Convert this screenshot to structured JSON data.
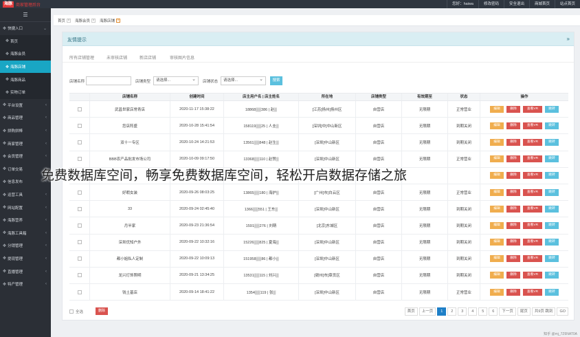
{
  "app": {
    "logo_text": "海豚",
    "logo_sub": "商家管理后台"
  },
  "top_links": [
    "您好：haiwa",
    "修改密码",
    "安全退出",
    "商城首页",
    "站点首页"
  ],
  "sidebar": {
    "toggle_icon": "menu-icon",
    "items": [
      {
        "label": "快捷入口",
        "sub": false,
        "active": false,
        "chev": "⌄"
      },
      {
        "label": "首页",
        "sub": true,
        "active": false,
        "chev": ""
      },
      {
        "label": "海豚会员",
        "sub": true,
        "active": false,
        "chev": ""
      },
      {
        "label": "海豚店铺",
        "sub": true,
        "active": true,
        "chev": ""
      },
      {
        "label": "海豚商品",
        "sub": true,
        "active": false,
        "chev": ""
      },
      {
        "label": "实物订单",
        "sub": true,
        "active": false,
        "chev": ""
      },
      {
        "label": "平台设置",
        "sub": false,
        "active": false,
        "chev": "‹"
      },
      {
        "label": "商品管理",
        "sub": false,
        "active": false,
        "chev": "‹"
      },
      {
        "label": "拼购拼棒",
        "sub": false,
        "active": false,
        "chev": "‹"
      },
      {
        "label": "商家管理",
        "sub": false,
        "active": false,
        "chev": "‹"
      },
      {
        "label": "会员管理",
        "sub": false,
        "active": false,
        "chev": "‹"
      },
      {
        "label": "订单交易",
        "sub": false,
        "active": false,
        "chev": "‹"
      },
      {
        "label": "信息发布",
        "sub": false,
        "active": false,
        "chev": "‹"
      },
      {
        "label": "运营工具",
        "sub": false,
        "active": false,
        "chev": "‹"
      },
      {
        "label": "网站配置",
        "sub": false,
        "active": false,
        "chev": "‹"
      },
      {
        "label": "海豚营养",
        "sub": false,
        "active": false,
        "chev": "‹"
      },
      {
        "label": "海豚工具箱",
        "sub": false,
        "active": false,
        "chev": "‹"
      },
      {
        "label": "分销管理",
        "sub": false,
        "active": false,
        "chev": "‹"
      },
      {
        "label": "提现管理",
        "sub": false,
        "active": false,
        "chev": "‹"
      },
      {
        "label": "直播管理",
        "sub": false,
        "active": false,
        "chev": "‹"
      },
      {
        "label": "特产管理",
        "sub": false,
        "active": false,
        "chev": "‹"
      }
    ]
  },
  "tabs": [
    {
      "label": "首页",
      "active": false
    },
    {
      "label": "海豚会员",
      "active": false
    },
    {
      "label": "海豚店铺",
      "active": true
    }
  ],
  "panel": {
    "title": "友情提示",
    "subtabs": [
      "所有店铺管理",
      "未审核店铺",
      "新店店铺",
      "审核图片信息"
    ]
  },
  "filters": {
    "name_label": "店铺名称",
    "type_label": "店铺类型",
    "type_value": "请选择...",
    "status_label": "店铺状态",
    "status_value": "请选择...",
    "search_label": "搜索"
  },
  "table": {
    "headers": [
      "",
      "店铺名称",
      "创建时间",
      "店主用户名 | 店主姓名",
      "所在地",
      "店铺类型",
      "有效期至",
      "状态",
      "操作"
    ],
    "rows": [
      {
        "name": "武昌世家店常青店",
        "created": "2020-11-17 15:38:22",
        "owner": "18868▒▒386 | 赵▒",
        "location": "[江苏]扬州]扬州区",
        "type": "自营店",
        "expire": "无限期",
        "status": "正常营业"
      },
      {
        "name": "您店阵盛",
        "created": "2020-10-28 15:41:54",
        "owner": "158119▒▒25 | 人圭▒",
        "location": "[深圳]中]中山新区",
        "type": "自营店",
        "expire": "无限期",
        "status": "到期关闭"
      },
      {
        "name": "双十一专区",
        "created": "2020-10-24 14:21:53",
        "owner": "13561▒▒848 | 赵生▒",
        "location": "[深圳]中山新区",
        "type": "自营店",
        "expire": "无限期",
        "status": "到期关闭"
      },
      {
        "name": "BBB农产品批发市场公司",
        "created": "2020-10-09 09:17:50",
        "owner": "13368▒▒110 | 赵赞▒",
        "location": "[深圳]中山新区",
        "type": "自营店",
        "expire": "无限期",
        "status": "正常营业"
      },
      {
        "name": "",
        "created": "",
        "owner": "",
        "location": "",
        "type": "",
        "expire": "",
        "status": ""
      },
      {
        "name": "好暇女装",
        "created": "2020-09-26 08:03:25",
        "owner": "13865▒▒180 | 海护▒",
        "location": "[广州]市]白云区",
        "type": "自营店",
        "expire": "无限期",
        "status": "正常营业"
      },
      {
        "name": "33",
        "created": "2020-09-24 02:45:40",
        "owner": "1366▒▒551 | 王东▒",
        "location": "[深圳]中山新区",
        "type": "自营店",
        "expire": "无限期",
        "status": "到期关闭"
      },
      {
        "name": "月半家",
        "created": "2020-09-23 21:36:54",
        "owner": "1591▒▒276 | 刘萌",
        "location": "[北京]东城区",
        "type": "自营店",
        "expire": "无限期",
        "status": "到期关闭"
      },
      {
        "name": "深圳优知户外",
        "created": "2020-09-22 10:32:16",
        "owner": "15226▒▒825 | 夏海▒",
        "location": "[深圳]中山新区",
        "type": "自营店",
        "expire": "无限期",
        "status": "到期关闭"
      },
      {
        "name": "都小姐私人定制",
        "created": "2020-09-22 10:09:13",
        "owner": "151958▒▒86 | 都小▒",
        "location": "[深圳]中山新区",
        "type": "自营店",
        "expire": "无限期",
        "status": "到期关闭"
      },
      {
        "name": "龙兴灯饰照明",
        "created": "2020-09-21 13:34:25",
        "owner": "13531▒▒115 | 刘兴▒",
        "location": "[赣州]市]章贡区",
        "type": "自营店",
        "expire": "无限期",
        "status": "到期关闭"
      },
      {
        "name": "钱土基店",
        "created": "2020-09-14 18:41:22",
        "owner": "1354▒▒119 | 张▒",
        "location": "[深圳]中山新区",
        "type": "自营店",
        "expire": "无限期",
        "status": "正常营业"
      }
    ],
    "op_labels": {
      "edit": "编辑",
      "del": "删除",
      "vr": "查看VR",
      "goto": "跳转"
    }
  },
  "footer": {
    "select_all": "全选",
    "delete": "删除",
    "pager": [
      "首页",
      "上一页",
      "1",
      "2",
      "3",
      "4",
      "5",
      "6",
      "下一页",
      "尾页",
      "共9页 跳到",
      "GO"
    ],
    "active_page": "1"
  },
  "watermark": "免费数据库空间，畅享免费数据库空间，轻松开启数据存储之旅",
  "bottom_note": "知乎 @mj_7Z6NAT0A"
}
